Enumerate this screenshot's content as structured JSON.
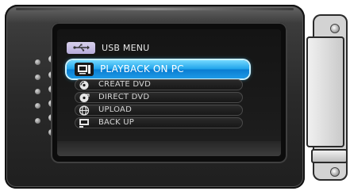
{
  "menu": {
    "title": "USB MENU",
    "header_icon": "usb-icon",
    "items": [
      {
        "label": "PLAYBACK ON PC",
        "icon": "monitor-icon",
        "selected": true
      },
      {
        "label": "CREATE DVD",
        "icon": "disc-icon",
        "selected": false
      },
      {
        "label": "DIRECT DVD",
        "icon": "disc-direct-icon",
        "selected": false
      },
      {
        "label": "UPLOAD",
        "icon": "globe-icon",
        "selected": false
      },
      {
        "label": "BACK UP",
        "icon": "backup-icon",
        "selected": false
      }
    ]
  },
  "colors": {
    "selection": "#1d9ae6",
    "selection_highlight": "#72d8ff",
    "header_chip": "#c7bde4",
    "body": "#2a2a2a"
  }
}
